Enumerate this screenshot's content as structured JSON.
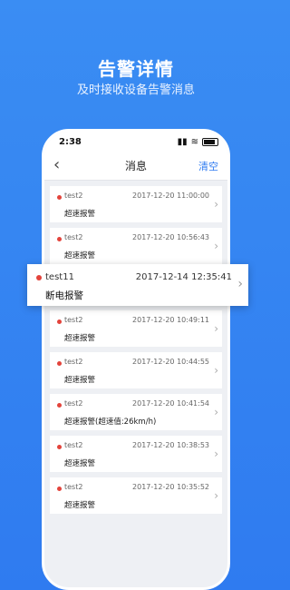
{
  "hero": {
    "title": "告警详情",
    "subtitle": "及时接收设备告警消息"
  },
  "status": {
    "time": "2:38",
    "signal": "▮▮",
    "wifi": "≋"
  },
  "nav": {
    "back": "‹",
    "title": "消息",
    "clear": "清空"
  },
  "messages": [
    {
      "name": "test2",
      "time": "2017-12-20 11:00:00",
      "text": "超速报警"
    },
    {
      "name": "test2",
      "time": "2017-12-20 10:56:43",
      "text": "超速报警"
    },
    {
      "name": "test2",
      "time": "2017-12-20 10:49:11",
      "text": "超速报警"
    },
    {
      "name": "test2",
      "time": "2017-12-20 10:44:55",
      "text": "超速报警"
    },
    {
      "name": "test2",
      "time": "2017-12-20 10:41:54",
      "text": "超速报警(超速值:26km/h)"
    },
    {
      "name": "test2",
      "time": "2017-12-20 10:38:53",
      "text": "超速报警"
    },
    {
      "name": "test2",
      "time": "2017-12-20 10:35:52",
      "text": "超速报警"
    }
  ],
  "highlight": {
    "name": "test11",
    "time": "2017-12-14 12:35:41",
    "text": "断电报警"
  },
  "colors": {
    "accent": "#2f7bf0",
    "dot": "#e3433b"
  }
}
